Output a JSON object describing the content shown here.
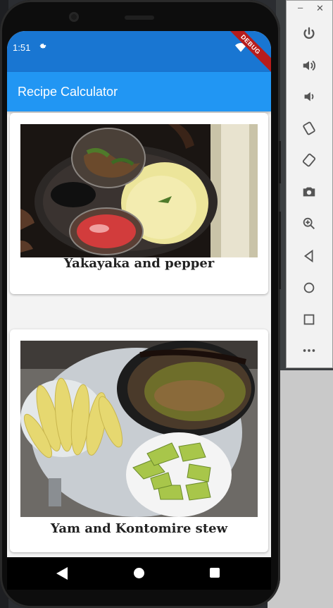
{
  "status_bar": {
    "time": "1:51",
    "debug_label": "DEBUG"
  },
  "app_bar": {
    "title": "Recipe Calculator"
  },
  "recipes": [
    {
      "title": "Yakayaka and pepper"
    },
    {
      "title": "Yam and Kontomire stew"
    },
    {
      "title": ""
    }
  ],
  "emulator_toolbar": {
    "items": [
      "power-icon",
      "volume-up-icon",
      "volume-down-icon",
      "rotate-left-icon",
      "rotate-right-icon",
      "camera-icon",
      "zoom-icon",
      "back-icon",
      "home-icon",
      "overview-icon",
      "more-icon"
    ]
  },
  "colors": {
    "app_bar": "#2196f3",
    "status_bar": "#1976d2",
    "debug_banner": "#b71c1c"
  }
}
